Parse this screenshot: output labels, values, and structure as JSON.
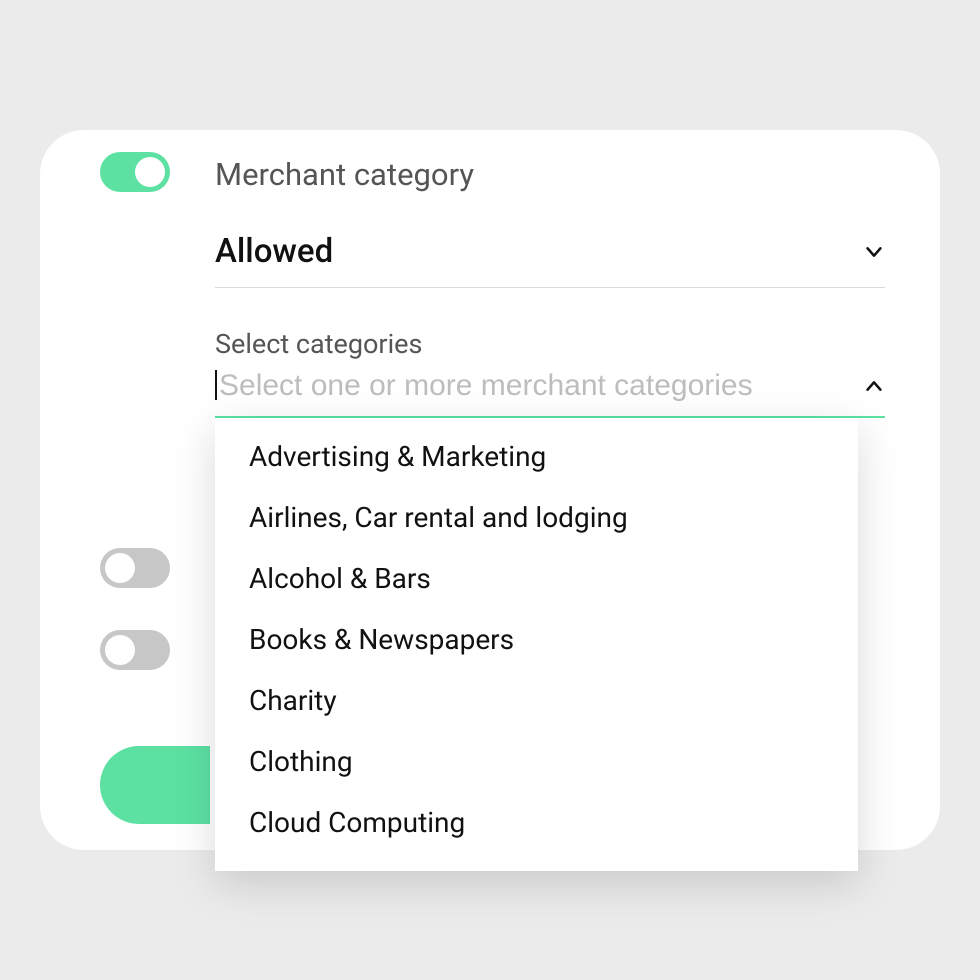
{
  "colors": {
    "accent": "#5CE1A3",
    "background": "#EBEBEB",
    "card": "#FFFFFF",
    "toggle_off": "#C7C7C7"
  },
  "merchant_category": {
    "title": "Merchant category",
    "toggle_on": true,
    "policy": {
      "value": "Allowed"
    },
    "categories_field": {
      "label": "Select categories",
      "placeholder": "Select one or more merchant categories",
      "value": "",
      "open": true,
      "options": [
        "Advertising & Marketing",
        "Airlines, Car rental and lodging",
        "Alcohol & Bars",
        "Books & Newspapers",
        "Charity",
        "Clothing",
        "Cloud Computing"
      ]
    }
  },
  "extra_toggles": [
    {
      "on": false
    },
    {
      "on": false
    }
  ]
}
